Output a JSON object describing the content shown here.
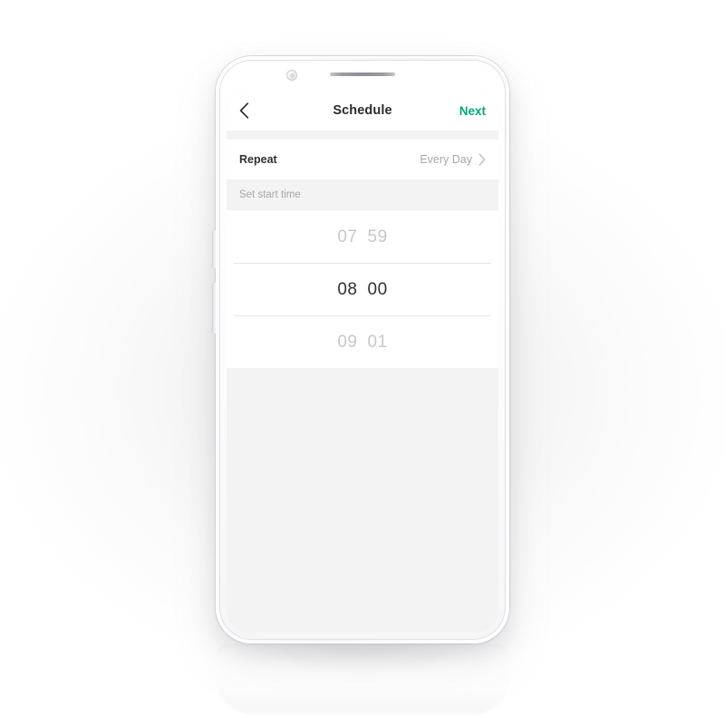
{
  "app": {
    "screen_title": "Schedule"
  },
  "navbar": {
    "back_icon": "chevron-left-icon",
    "title": "Schedule",
    "next_label": "Next",
    "next_color": "#0aa37f",
    "title_color": "#2a2a2e",
    "background": "#ffffff"
  },
  "settings": {
    "repeat_row": {
      "label": "Repeat",
      "value": "Every Day",
      "disclosure_icon": "chevron-right-icon",
      "label_color": "#303034",
      "value_color": "#a8a8ad"
    }
  },
  "section": {
    "start_time_header": "Set start time",
    "header_color": "#a6a6ab",
    "header_background": "#f3f3f4"
  },
  "time_picker": {
    "selected_hour": "08",
    "selected_minute": "00",
    "selected_color": "#303034",
    "dim_color": "#c7c7cc",
    "separator_color": "#e6e6e9",
    "rows": [
      {
        "hour": "07",
        "minute": "59",
        "state": "dim"
      },
      {
        "hour": "08",
        "minute": "00",
        "state": "selected"
      },
      {
        "hour": "09",
        "minute": "01",
        "state": "dim"
      }
    ]
  },
  "device": {
    "camera_icon": "front-camera-icon",
    "speaker_icon": "earpiece-speaker-icon",
    "volume_button": "volume-button",
    "power_button": "power-button",
    "body_color": "#f6f6f7",
    "screen_background": "#f3f3f4"
  }
}
